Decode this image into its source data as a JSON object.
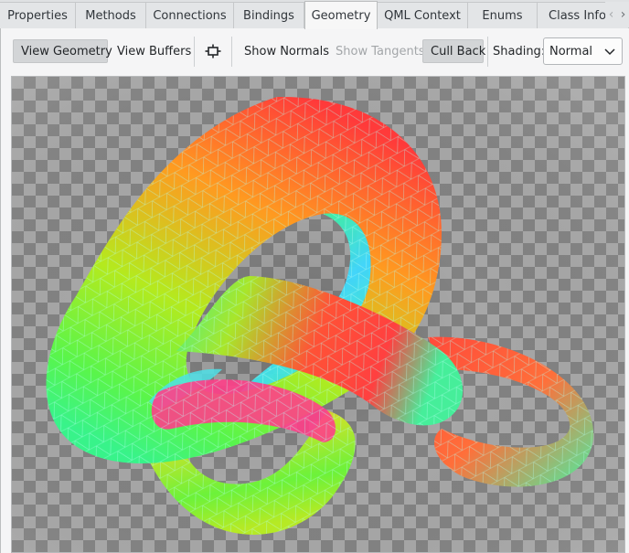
{
  "tabs": [
    {
      "label": "Properties",
      "active": false
    },
    {
      "label": "Methods",
      "active": false
    },
    {
      "label": "Connections",
      "active": false
    },
    {
      "label": "Bindings",
      "active": false
    },
    {
      "label": "Geometry",
      "active": true
    },
    {
      "label": "QML Context",
      "active": false
    },
    {
      "label": "Enums",
      "active": false
    },
    {
      "label": "Class Info",
      "active": false
    }
  ],
  "tab_scroll": {
    "left_icon": "chevron-left-icon",
    "right_icon": "chevron-right-icon"
  },
  "toolbar": {
    "view_geometry": "View Geometry",
    "view_buffers": "View Buffers",
    "reset_camera_icon": "camera-reset-icon",
    "show_normals": "Show Normals",
    "show_tangents": "Show Tangents",
    "cull_back": "Cull Back",
    "shading_label": "Shading:",
    "shading_value": "Normal"
  },
  "viewport": {
    "checker_light": "#a7a7a7",
    "checker_dark": "#828282",
    "mesh_wire_color": "#9cf5e6",
    "gradient_colors": [
      "#ff3a3a",
      "#ff9a20",
      "#b4ea1e",
      "#38f38a",
      "#3ed8ff"
    ]
  }
}
